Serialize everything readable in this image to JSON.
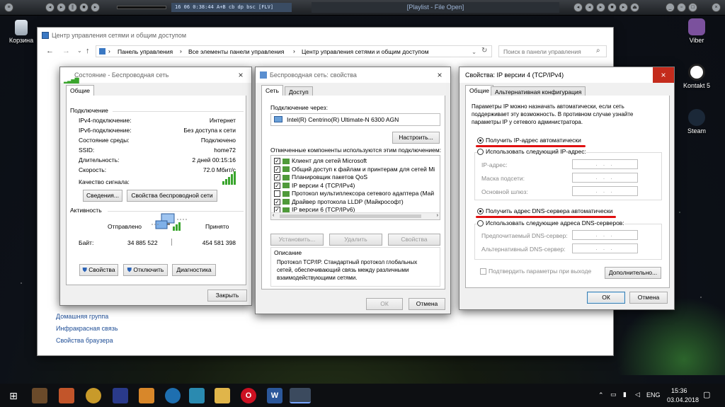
{
  "player": {
    "lcd": "16    06    0:38:44   A+B cb  dp  bsc  [FLV]",
    "title": "[Playlist - File Open]"
  },
  "desktop": {
    "icons": [
      "Корзина",
      "Viber",
      "Kontakt 5",
      "Steam"
    ]
  },
  "explorer": {
    "title": "Центр управления сетями и общим доступом",
    "breadcrumb": [
      "Панель управления",
      "Все элементы панели управления",
      "Центр управления сетями и общим доступом"
    ],
    "search_placeholder": "Поиск в панели управления",
    "links": [
      "Домашняя группа",
      "Инфракрасная связь",
      "Свойства браузера"
    ]
  },
  "status": {
    "title": "Состояние - Беспроводная сеть",
    "tab": "Общие",
    "conn_header": "Подключение",
    "rows": [
      {
        "k": "IPv4-подключение:",
        "v": "Интернет"
      },
      {
        "k": "IPv6-подключение:",
        "v": "Без доступа к сети"
      },
      {
        "k": "Состояние среды:",
        "v": "Подключено"
      },
      {
        "k": "SSID:",
        "v": "home72"
      },
      {
        "k": "Длительность:",
        "v": "2 дней 00:15:16"
      },
      {
        "k": "Скорость:",
        "v": "72.0 Мбит/с"
      }
    ],
    "signal_label": "Качество сигнала:",
    "btn_details": "Сведения...",
    "btn_wprops": "Свойства беспроводной сети",
    "activity_header": "Активность",
    "sent": "Отправлено",
    "recv": "Принято",
    "bytes": "Байт:",
    "sent_val": "34 885 522",
    "recv_val": "454 581 398",
    "btn_props": "Свойства",
    "btn_disable": "Отключить",
    "btn_diag": "Диагностика",
    "btn_close": "Закрыть",
    "signal_bars": 5
  },
  "wprops": {
    "title": "Беспроводная сеть: свойства",
    "tab1": "Сеть",
    "tab2": "Доступ",
    "via_label": "Подключение через:",
    "adapter": "Intel(R) Centrino(R) Ultimate-N 6300 AGN",
    "btn_configure": "Настроить...",
    "components_label": "Отмеченные компоненты используются этим подключением:",
    "items": [
      {
        "c": true,
        "t": "Клиент для сетей Microsoft"
      },
      {
        "c": true,
        "t": "Общий доступ к файлам и принтерам для сетей Mi"
      },
      {
        "c": true,
        "t": "Планировщик пакетов QoS"
      },
      {
        "c": true,
        "t": "IP версии 4 (TCP/IPv4)"
      },
      {
        "c": false,
        "t": "Протокол мультиплексора сетевого адаптера (Май"
      },
      {
        "c": true,
        "t": "Драйвер протокола LLDP (Майкрософт)"
      },
      {
        "c": true,
        "t": "IP версии 6 (TCP/IPv6)"
      }
    ],
    "btn_install": "Установить...",
    "btn_remove": "Удалить",
    "btn_props": "Свойства",
    "desc_label": "Описание",
    "desc": [
      "Протокол TCP/IP. Стандартный протокол глобальных",
      "сетей, обеспечивающий связь между различными",
      "взаимодействующими сетями."
    ],
    "btn_ok": "ОК",
    "btn_cancel": "Отмена"
  },
  "ipv4": {
    "title": "Свойства: IP версии 4 (TCP/IPv4)",
    "tab1": "Общие",
    "tab2": "Альтернативная конфигурация",
    "intro": [
      "Параметры IP можно назначать автоматически, если сеть",
      "поддерживает эту возможность. В противном случае узнайте",
      "параметры IP у сетевого администратора."
    ],
    "auto_ip": "Получить IP-адрес автоматически",
    "manual_ip": "Использовать следующий IP-адрес:",
    "ip_label": "IP-адрес:",
    "mask_label": "Маска подсети:",
    "gw_label": "Основной шлюз:",
    "auto_dns": "Получить адрес DNS-сервера автоматически",
    "manual_dns": "Использовать следующие адреса DNS-серверов:",
    "dns1_label": "Предпочитаемый DNS-сервер:",
    "dns2_label": "Альтернативный DNS-сервер:",
    "validate": "Подтвердить параметры при выходе",
    "btn_advanced": "Дополнительно...",
    "btn_ok": "ОК",
    "btn_cancel": "Отмена",
    "ip_placeholder": ".    .    ."
  },
  "taskbar": {
    "lang": "ENG",
    "time": "15:36",
    "date": "03.04.2018"
  },
  "colors": {
    "accent_red": "#e01010",
    "link": "#1f4e96",
    "signal": "#3aa52d"
  }
}
